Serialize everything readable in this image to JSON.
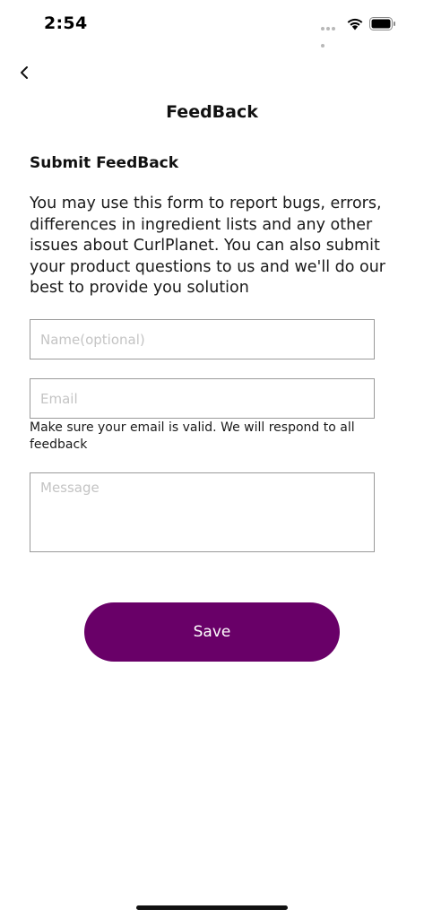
{
  "status_bar": {
    "time": "2:54"
  },
  "header": {
    "back_icon": "chevron-left-icon",
    "title": "FeedBack"
  },
  "form": {
    "section_title": "Submit FeedBack",
    "description": "You may use this form to report bugs, errors, differences in ingredient lists and any other issues about CurlPlanet. You can also submit your product questions to us and we'll do our best to provide you solution",
    "name_placeholder": "Name(optional)",
    "name_value": "",
    "email_placeholder": "Email",
    "email_value": "",
    "email_hint": "Make sure your email is valid. We will respond to all feedback",
    "message_placeholder": "Message",
    "message_value": "",
    "save_label": "Save"
  },
  "colors": {
    "accent": "#690068",
    "text": "#111111",
    "field_border": "#9a9a9a",
    "placeholder": "#c4c4c4"
  }
}
